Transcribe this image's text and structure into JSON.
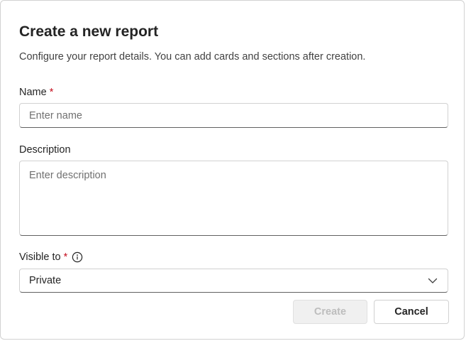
{
  "dialog": {
    "title": "Create a new report",
    "subtitle": "Configure your report details. You can add cards and sections after creation."
  },
  "fields": {
    "name": {
      "label": "Name",
      "required_mark": "*",
      "value": "",
      "placeholder": "Enter name"
    },
    "description": {
      "label": "Description",
      "value": "",
      "placeholder": "Enter description"
    },
    "visible_to": {
      "label": "Visible to",
      "required_mark": "*",
      "selected": "Private",
      "info_icon": "info-icon",
      "chevron_icon": "chevron-down-icon"
    }
  },
  "actions": {
    "create_label": "Create",
    "create_disabled": true,
    "cancel_label": "Cancel"
  },
  "colors": {
    "required": "#c50f1f",
    "text": "#242424",
    "disabled_bg": "#f0f0f0",
    "disabled_text": "#bdbdbd"
  }
}
